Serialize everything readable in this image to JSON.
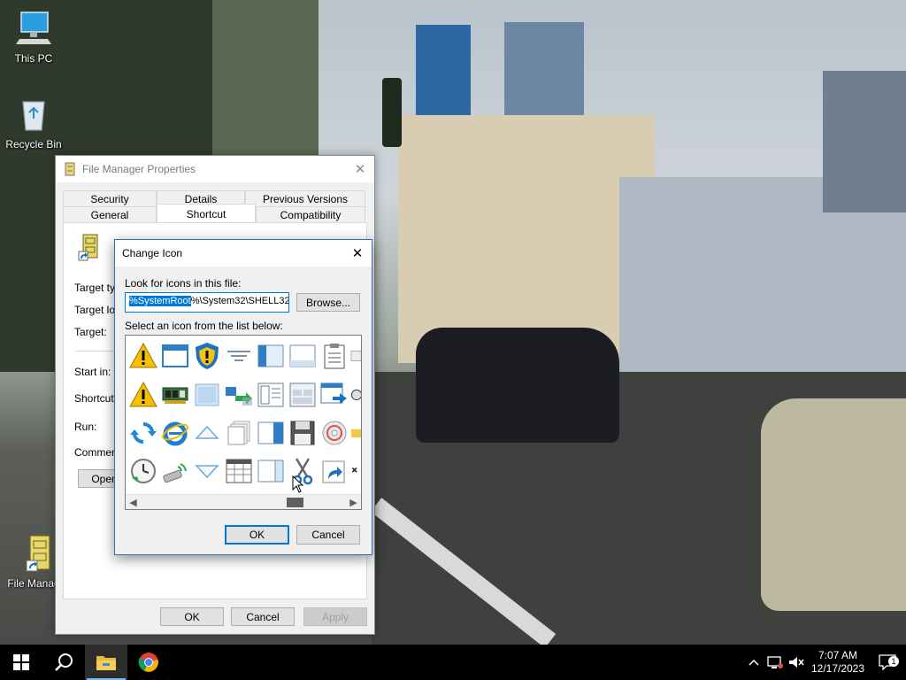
{
  "desktop": {
    "icons": [
      {
        "label": "This PC",
        "icon": "computer-icon"
      },
      {
        "label": "Recycle Bin",
        "icon": "recycle-bin-icon"
      },
      {
        "label": "File Manag",
        "icon": "file-cabinet-shortcut-icon"
      }
    ]
  },
  "properties_window": {
    "title": "File Manager Properties",
    "tabs_row1": [
      "Security",
      "Details",
      "Previous Versions"
    ],
    "tabs_row2": [
      "General",
      "Shortcut",
      "Compatibility"
    ],
    "active_tab": "Shortcut",
    "fields": [
      "Target typ",
      "Target loc",
      "Target:",
      "Start in:",
      "Shortcut k",
      "Run:",
      "Comment:"
    ],
    "open_button": "Open",
    "ok_label": "OK",
    "cancel_label": "Cancel",
    "apply_label": "Apply"
  },
  "change_icon_dialog": {
    "title": "Change Icon",
    "file_label": "Look for icons in this file:",
    "file_value_selected": "%SystemRoot",
    "file_value_rest": "%\\System32\\SHELL32",
    "browse_label": "Browse...",
    "list_label": "Select an icon from the list below:",
    "ok_label": "OK",
    "cancel_label": "Cancel",
    "icons": [
      [
        "warning-icon",
        "window-icon",
        "shield-icon",
        "filter-icon",
        "sidebar-window-icon",
        "window-frame-icon",
        "clipboard-icon",
        "partial-icon"
      ],
      [
        "warning-icon",
        "network-card-icon",
        "blank-window-icon",
        "transfer-icon",
        "document-columns-icon",
        "grid-window-icon",
        "window-arrow-icon",
        "partial-circle-icon"
      ],
      [
        "refresh-icon",
        "internet-explorer-icon",
        "triangle-up-icon",
        "stacked-pages-icon",
        "split-window-icon",
        "floppy-disk-icon",
        "cd-disc-icon",
        "partial-folder-icon"
      ],
      [
        "clock-icon",
        "usb-wireless-icon",
        "triangle-down-icon",
        "table-window-icon",
        "pane-window-icon",
        "scissors-icon",
        "shortcut-arrow-icon",
        "delete-x-icon"
      ]
    ]
  },
  "taskbar": {
    "time": "7:07 AM",
    "date": "12/17/2023",
    "notification_count": "1"
  }
}
